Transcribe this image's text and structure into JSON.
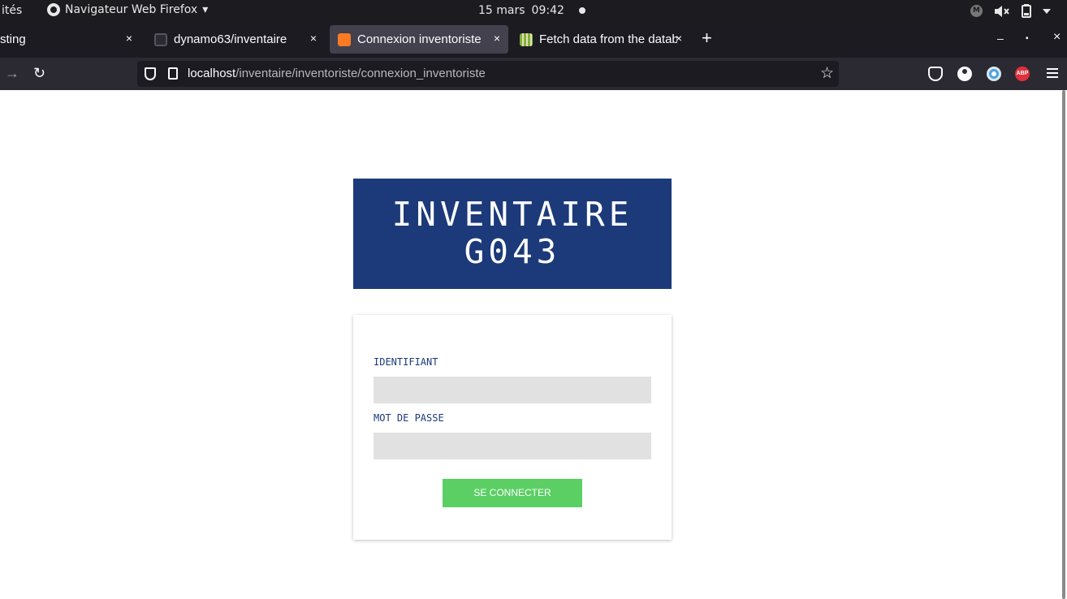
{
  "system_bar": {
    "activities": "ités",
    "app_menu": "Navigateur Web Firefox",
    "app_menu_arrow": "▾",
    "date": "15 mars",
    "time": "09:42",
    "tray_m": "M"
  },
  "tabs": [
    {
      "title": "sting",
      "close": "×",
      "active": false
    },
    {
      "title": "dynamo63/inventaire",
      "close": "×",
      "active": false,
      "icon": "github-icon"
    },
    {
      "title": "Connexion inventoriste",
      "close": "×",
      "active": true,
      "icon": "xampp-icon"
    },
    {
      "title": "Fetch data from the datab",
      "close": "×",
      "active": false,
      "icon": "book-icon"
    }
  ],
  "tabstrip": {
    "new_tab": "+",
    "minimize": "–",
    "maximize": "▪",
    "close": "×"
  },
  "navbar": {
    "back": "→",
    "reload": "↻",
    "url_host": "localhost",
    "url_path": "/inventaire/inventoriste/connexion_inventoriste",
    "bookmark_star": "☆",
    "abp_label": "ABP"
  },
  "page": {
    "banner_line1": "INVENTAIRE",
    "banner_line2": "G043",
    "form": {
      "username_label": "IDENTIFIANT",
      "username_value": "",
      "password_label": "MOT DE PASSE",
      "password_value": "",
      "submit_label": "SE CONNECTER"
    }
  },
  "colors": {
    "banner_bg": "#1c3a7a",
    "label_color": "#1c3a7a",
    "field_bg": "#e1e1e1",
    "submit_bg": "#5bcf63",
    "active_tab_bg": "#42414d"
  }
}
